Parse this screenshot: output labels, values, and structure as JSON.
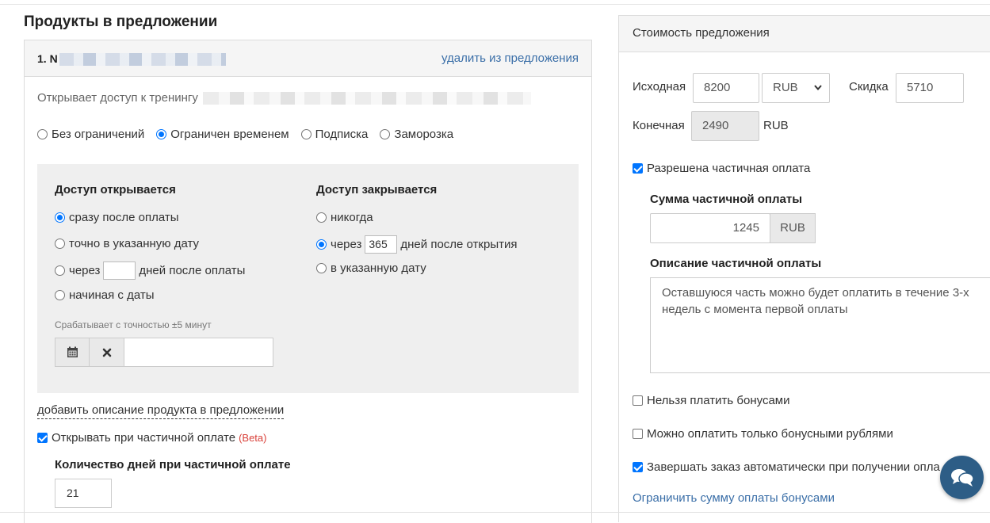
{
  "products": {
    "title": "Продукты в предложении",
    "item_number": "1. N",
    "remove_link": "удалить из предложения",
    "opens_access": "Открывает доступ к тренингу",
    "access_types": [
      {
        "label": "Без ограничений",
        "checked": false
      },
      {
        "label": "Ограничен временем",
        "checked": true
      },
      {
        "label": "Подписка",
        "checked": false
      },
      {
        "label": "Заморозка",
        "checked": false
      }
    ],
    "opens": {
      "title": "Доступ открывается",
      "immediately": "сразу после оплаты",
      "exact_date": "точно в указанную дату",
      "after_prefix": "через",
      "after_suffix": "дней после оплаты",
      "starting_from": "начиная с даты",
      "hint": "Срабатывает с точностью ±5 минут"
    },
    "closes": {
      "title": "Доступ закрывается",
      "never": "никогда",
      "after_prefix": "через",
      "after_days": "365",
      "after_suffix": "дней после открытия",
      "on_date": "в указанную дату"
    },
    "add_description": "добавить описание продукта в предложении",
    "open_partial": "Открывать при частичной оплате",
    "beta": "(Beta)",
    "partial_days_label": "Количество дней при частичной оплате",
    "partial_days_value": "21"
  },
  "pricing": {
    "title": "Стоимость предложения",
    "original_label": "Исходная",
    "original_value": "8200",
    "currency": "RUB",
    "discount_label": "Скидка",
    "discount_value": "5710",
    "final_label": "Конечная",
    "final_value": "2490",
    "final_currency": "RUB",
    "partial_allowed": "Разрешена частичная оплата",
    "partial_sum_label": "Сумма частичной оплаты",
    "partial_sum_value": "1245",
    "partial_currency": "RUB",
    "partial_desc_label": "Описание частичной оплаты",
    "partial_desc_text": "Оставшуюся часть можно будет оплатить в течение 3-х недель с момента первой оплаты",
    "no_bonus": "Нельзя платить бонусами",
    "only_bonus": "Можно оплатить только бонусными рублями",
    "auto_complete": "Завершать заказ автоматически при получении опла",
    "limit_bonus_link": "Ограничить сумму оплаты бонусами"
  },
  "icons": {
    "calendar": "calendar-icon",
    "clear": "close-icon",
    "chat": "chat-icon",
    "select_arrow": "chevron-down-icon"
  },
  "colors": {
    "link": "#3b6fa8",
    "accent": "#0075ff",
    "beta": "#d9413a",
    "chat": "#2d5d86"
  }
}
